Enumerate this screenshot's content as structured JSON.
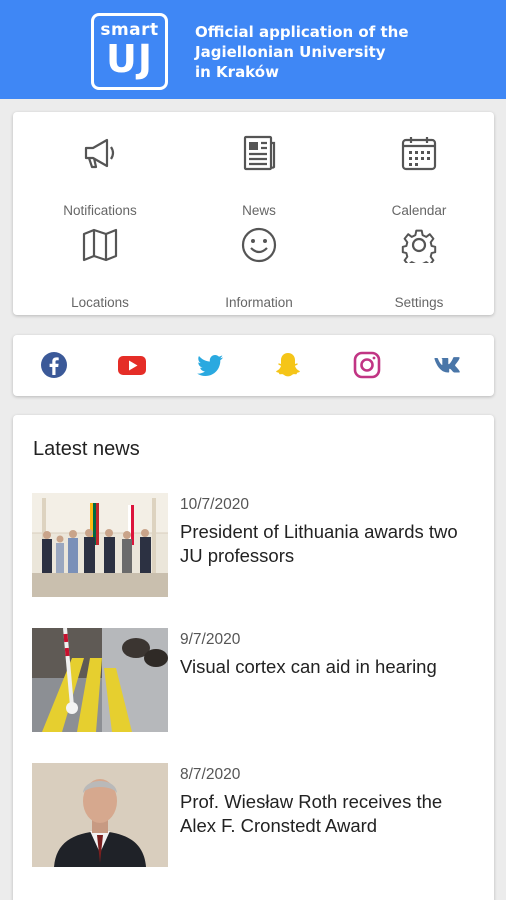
{
  "header": {
    "logo": {
      "small": "smart",
      "big": "UJ"
    },
    "title_lines": [
      "Official application of the",
      "Jagiellonian University",
      "in Kraków"
    ]
  },
  "menu": [
    {
      "label": "Notifications",
      "icon": "megaphone-icon"
    },
    {
      "label": "News",
      "icon": "newspaper-icon"
    },
    {
      "label": "Calendar",
      "icon": "calendar-icon"
    },
    {
      "label": "Locations",
      "icon": "map-icon"
    },
    {
      "label": "Information",
      "icon": "smiley-icon"
    },
    {
      "label": "Settings",
      "icon": "gear-icon"
    }
  ],
  "social": [
    {
      "name": "facebook",
      "color": "#3b5998"
    },
    {
      "name": "youtube",
      "color": "#e52d27"
    },
    {
      "name": "twitter",
      "color": "#2aa9e0"
    },
    {
      "name": "snapchat",
      "color": "#f5c518"
    },
    {
      "name": "instagram",
      "color": "#c13584"
    },
    {
      "name": "vk",
      "color": "#4a76a8"
    }
  ],
  "news": {
    "heading": "Latest news",
    "items": [
      {
        "date": "10/7/2020",
        "title": "President of Lithuania awards two JU professors"
      },
      {
        "date": "9/7/2020",
        "title": "Visual cortex can aid in hearing"
      },
      {
        "date": "8/7/2020",
        "title": "Prof. Wiesław Roth receives the Alex F. Cronstedt Award"
      }
    ]
  },
  "colors": {
    "header": "#3f87f5",
    "icon": "#555555"
  }
}
